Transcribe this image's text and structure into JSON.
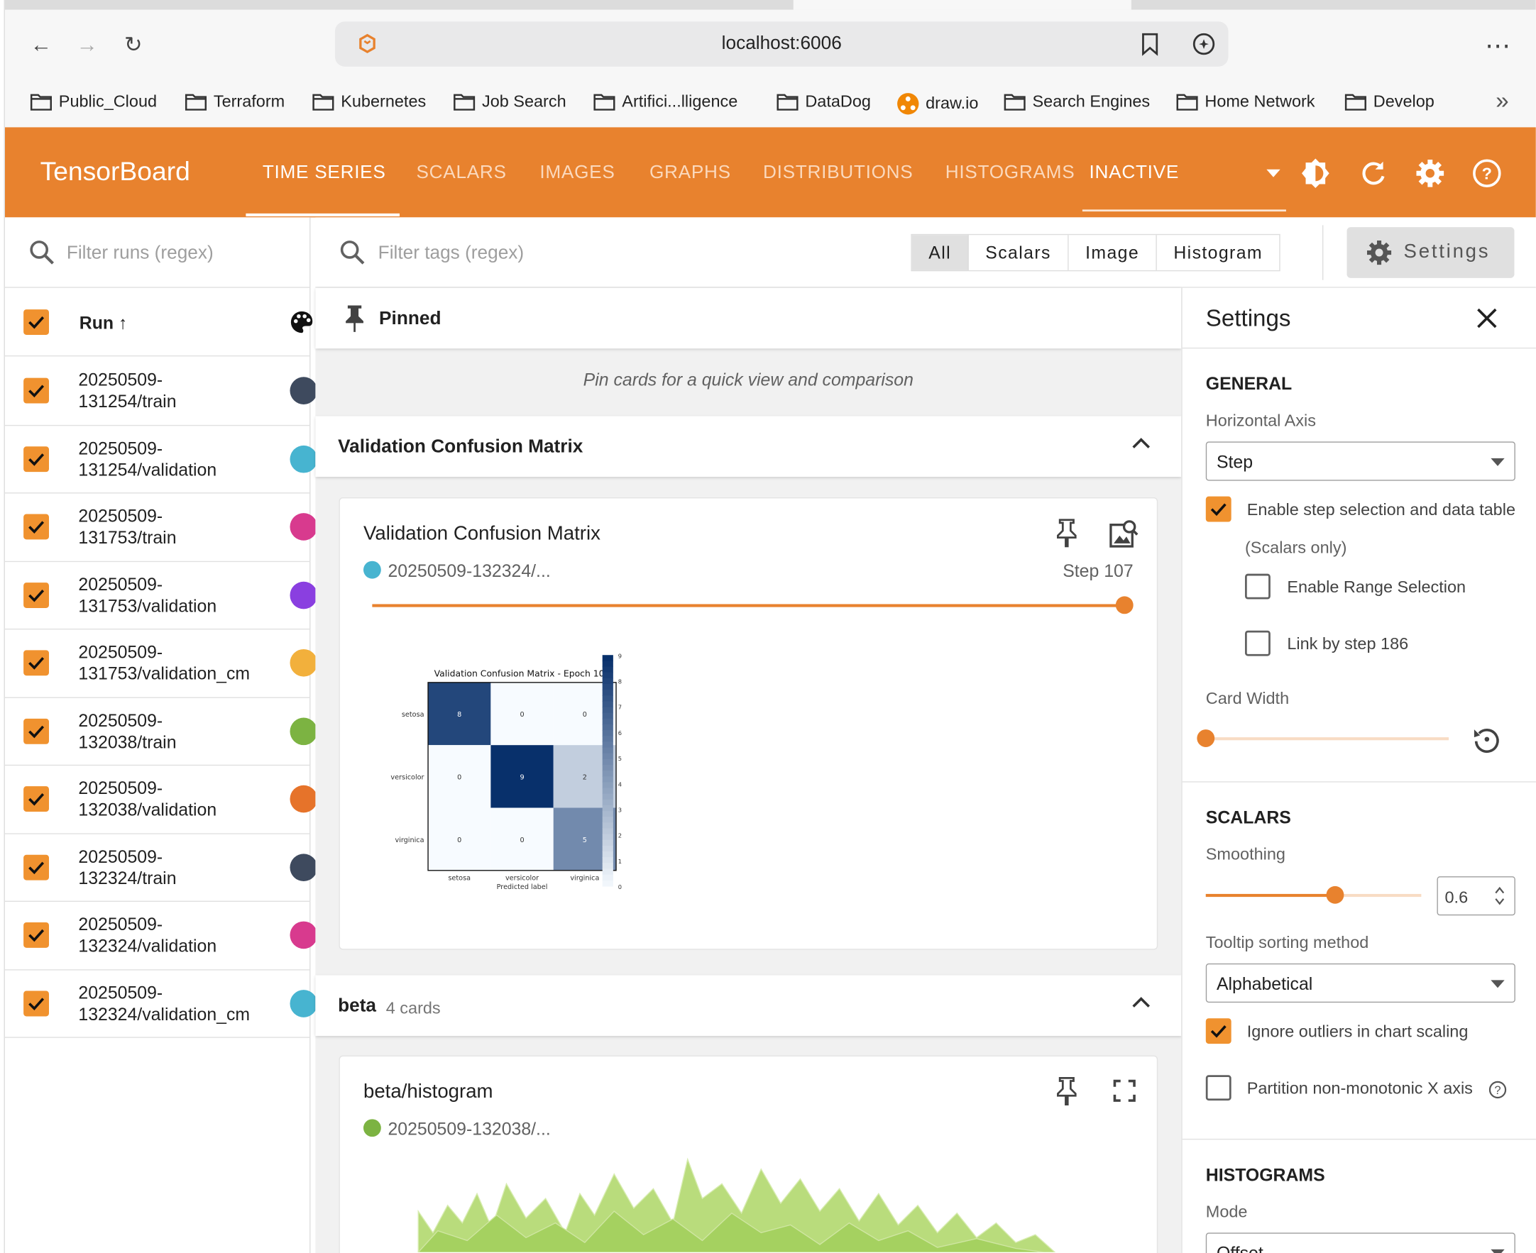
{
  "browser": {
    "url": "localhost:6006",
    "bookmarks": [
      "Public_Cloud",
      "Terraform",
      "Kubernetes",
      "Job Search",
      "Artifici...lligence",
      "DataDog",
      "draw.io",
      "Search Engines",
      "Home Network",
      "Develop"
    ],
    "more_label": "»"
  },
  "header": {
    "title": "TensorBoard",
    "tabs": [
      "TIME SERIES",
      "SCALARS",
      "IMAGES",
      "GRAPHS",
      "DISTRIBUTIONS",
      "HISTOGRAMS"
    ],
    "active_tab": "TIME SERIES",
    "inactive_label": "INACTIVE",
    "brand_color": "#e8822e"
  },
  "runs": {
    "filter_placeholder": "Filter runs (regex)",
    "column_label": "Run ↑",
    "items": [
      {
        "line1": "20250509-",
        "line2": "131254/train",
        "color": "#3e4a5e",
        "checked": true
      },
      {
        "line1": "20250509-",
        "line2": "131254/validation",
        "color": "#47b4d0",
        "checked": true
      },
      {
        "line1": "20250509-",
        "line2": "131753/train",
        "color": "#d83a8e",
        "checked": true
      },
      {
        "line1": "20250509-",
        "line2": "131753/validation",
        "color": "#8a3fe0",
        "checked": true
      },
      {
        "line1": "20250509-",
        "line2": "131753/validation_cm",
        "color": "#f2b03c",
        "checked": true
      },
      {
        "line1": "20250509-",
        "line2": "132038/train",
        "color": "#7cb342",
        "checked": true
      },
      {
        "line1": "20250509-",
        "line2": "132038/validation",
        "color": "#e6732a",
        "checked": true
      },
      {
        "line1": "20250509-",
        "line2": "132324/train",
        "color": "#3e4a5e",
        "checked": true
      },
      {
        "line1": "20250509-",
        "line2": "132324/validation",
        "color": "#d83a8e",
        "checked": true
      },
      {
        "line1": "20250509-",
        "line2": "132324/validation_cm",
        "color": "#47b4d0",
        "checked": true
      }
    ]
  },
  "tags": {
    "filter_placeholder": "Filter tags (regex)",
    "filters": [
      "All",
      "Scalars",
      "Image",
      "Histogram"
    ],
    "selected_filter": "All",
    "settings_button": "Settings"
  },
  "main": {
    "pinned_title": "Pinned",
    "pinned_hint": "Pin cards for a quick view and comparison",
    "group1_title": "Validation Confusion Matrix",
    "cm_card": {
      "title": "Validation Confusion Matrix",
      "run": "20250509-132324/...",
      "run_color": "#47b4d0",
      "step_label": "Step 107",
      "step_progress": 1.0,
      "image": {
        "title": "Validation Confusion Matrix - Epoch 107",
        "labels": [
          "setosa",
          "versicolor",
          "virginica"
        ],
        "xlabel": "Predicted label",
        "matrix": [
          [
            8,
            0,
            0
          ],
          [
            0,
            9,
            2
          ],
          [
            0,
            0,
            5
          ]
        ],
        "colorbar_ticks": [
          "0",
          "1",
          "2",
          "3",
          "4",
          "5",
          "6",
          "7",
          "8",
          "9"
        ]
      }
    },
    "group2_title": "beta",
    "group2_count": "4 cards",
    "hist_card": {
      "title": "beta/histogram",
      "run": "20250509-132038/...",
      "run_color": "#7cb342"
    }
  },
  "settings": {
    "title": "Settings",
    "general": {
      "heading": "GENERAL",
      "horizontal_axis_label": "Horizontal Axis",
      "horizontal_axis_value": "Step",
      "enable_step_label": "Enable step selection and data table",
      "scalars_only": "(Scalars only)",
      "enable_step_checked": true,
      "range_selection_label": "Enable Range Selection",
      "range_selection_checked": false,
      "link_by_step_label": "Link by step 186",
      "link_by_step_checked": false,
      "card_width_label": "Card Width",
      "card_width_value": 0.0
    },
    "scalars": {
      "heading": "SCALARS",
      "smoothing_label": "Smoothing",
      "smoothing_value": "0.6",
      "tooltip_label": "Tooltip sorting method",
      "tooltip_value": "Alphabetical",
      "ignore_outliers_label": "Ignore outliers in chart scaling",
      "ignore_outliers_checked": true,
      "partition_label": "Partition non-monotonic X axis",
      "partition_checked": false
    },
    "histograms": {
      "heading": "HISTOGRAMS",
      "mode_label": "Mode",
      "mode_value": "Offset"
    }
  }
}
